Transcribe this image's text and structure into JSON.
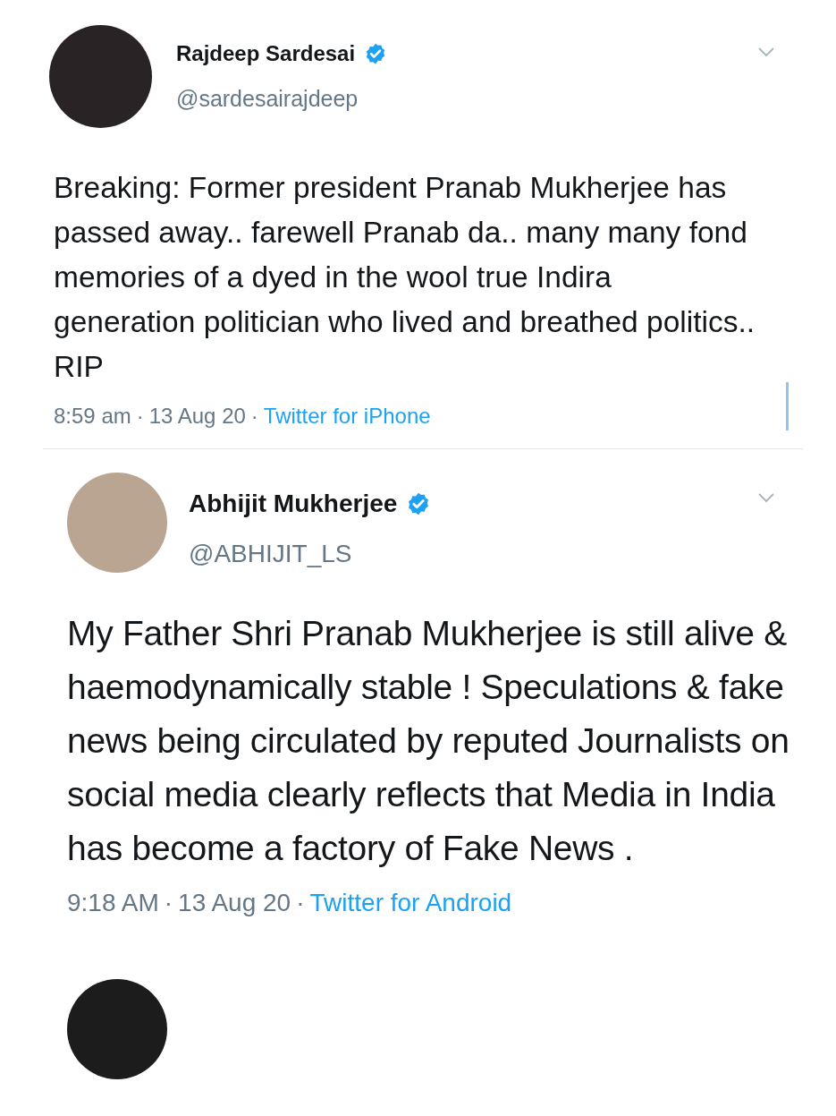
{
  "tweets": [
    {
      "name": "Rajdeep Sardesai",
      "verified": true,
      "handle": "@sardesairajdeep",
      "text": "Breaking: Former president Pranab Mukherjee has passed away.. farewell Pranab da.. many many fond memories of a dyed in the wool true Indira generation politician who lived and breathed politics.. RIP",
      "time": "8:59 am",
      "separator_1": "·",
      "date": "13 Aug 20",
      "separator_2": "·",
      "source": "Twitter for iPhone"
    },
    {
      "name": "Abhijit Mukherjee",
      "verified": true,
      "handle": "@ABHIJIT_LS",
      "text": "My Father Shri Pranab Mukherjee is still alive & haemodynamically stable ! Speculations & fake news being circulated by reputed Journalists on social media clearly reflects that Media in India has become a factory of Fake News .",
      "time": "9:18 AM",
      "separator_1": "·",
      "date": "13 Aug 20",
      "separator_2": "·",
      "source": "Twitter for Android"
    }
  ]
}
